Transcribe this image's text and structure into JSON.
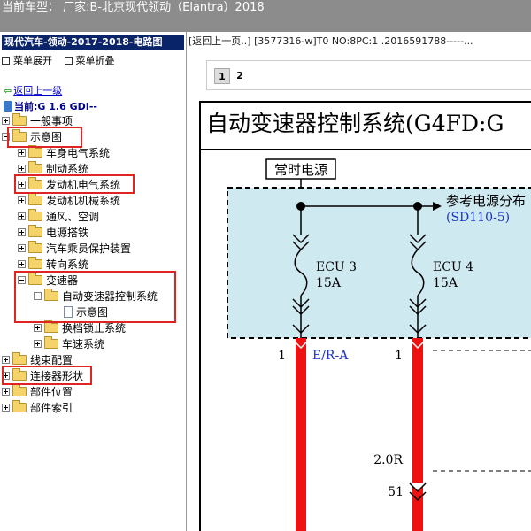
{
  "topbar": {
    "title": "当前车型： 厂家:B-北京现代领动（Elantra）2018"
  },
  "left": {
    "title": "现代汽车-领动-2017-2018-电路图",
    "toolbar": {
      "expand": "菜单展开",
      "collapse": "菜单折叠"
    },
    "back": "返回上一级",
    "current": "当前:G 1.6 GDI--",
    "tree": [
      {
        "label": "一般事项",
        "icon": "folder-icon"
      },
      {
        "label": "示意图",
        "icon": "folder-icon"
      },
      {
        "label": "车身电气系统",
        "icon": "folder-icon"
      },
      {
        "label": "制动系统",
        "icon": "folder-icon"
      },
      {
        "label": "发动机电气系统",
        "icon": "folder-icon"
      },
      {
        "label": "发动机机械系统",
        "icon": "folder-icon"
      },
      {
        "label": "通风、空调",
        "icon": "folder-icon"
      },
      {
        "label": "电源搭铁",
        "icon": "folder-icon"
      },
      {
        "label": "汽车乘员保护装置",
        "icon": "folder-icon"
      },
      {
        "label": "转向系统",
        "icon": "folder-icon"
      },
      {
        "label": "变速器",
        "icon": "folder-icon"
      },
      {
        "label": "自动变速器控制系统",
        "icon": "folder-icon"
      },
      {
        "label": "示意图",
        "icon": "document-icon"
      },
      {
        "label": "换档锁止系统",
        "icon": "folder-icon"
      },
      {
        "label": "车速系统",
        "icon": "folder-icon"
      },
      {
        "label": "线束配置",
        "icon": "folder-icon"
      },
      {
        "label": "连接器形状",
        "icon": "folder-icon"
      },
      {
        "label": "部件位置",
        "icon": "folder-icon"
      },
      {
        "label": "部件索引",
        "icon": "folder-icon"
      }
    ]
  },
  "right": {
    "header": "[返回上一页..] [3577316-w]T0 NO:8PC:1 .2016591788-----...",
    "pages": [
      "1",
      "2"
    ],
    "diagram": {
      "title": "自动变速器控制系统(G4FD:G",
      "power_label": "常时电源",
      "ref_label": "参考电源分布",
      "ref_code": "(SD110-5)",
      "fuse1_name": "ECU 3",
      "fuse1_rating": "15A",
      "fuse2_name": "ECU 4",
      "fuse2_rating": "15A",
      "pin1_left": "1",
      "wire_color": "E/R-A",
      "pin1_right": "1",
      "engine_label": "2.0R",
      "pin51": "51"
    },
    "colors": {
      "fuse_box_fill": "#cfe9f0",
      "wire": "#ee1111",
      "ref_text": "#1a35c8"
    }
  }
}
